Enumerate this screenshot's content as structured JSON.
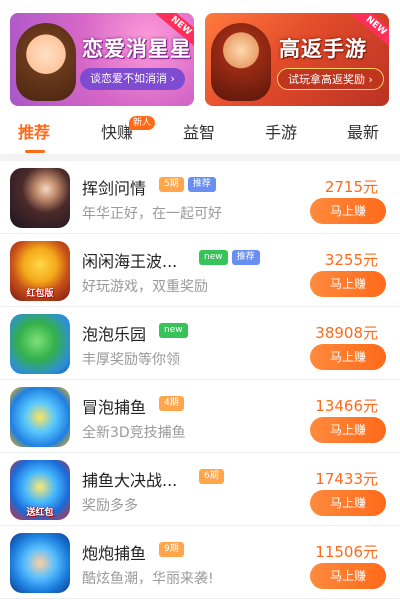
{
  "banners": [
    {
      "title": "恋爱消星星",
      "button": "谈恋爱不如消消 ›",
      "badge": "NEW",
      "mascot_icon": "anime-girl-icon"
    },
    {
      "title": "高返手游",
      "button": "试玩拿高返奖励 ›",
      "badge": "NEW",
      "mascot_icon": "hero-warrior-icon"
    }
  ],
  "tabs": [
    {
      "label": "推荐",
      "active": true
    },
    {
      "label": "快赚",
      "badge": "新人"
    },
    {
      "label": "益智"
    },
    {
      "label": "手游"
    },
    {
      "label": "最新"
    }
  ],
  "games": [
    {
      "name": "挥剑问情",
      "tags": [
        "5期",
        "推荐"
      ],
      "tag_types": [
        "period",
        "rec"
      ],
      "desc": "年华正好，在一起可好",
      "price": "2715元",
      "button": "马上赚",
      "icon_text": ""
    },
    {
      "name": "闲闲海王波...",
      "tags": [
        "new",
        "推荐"
      ],
      "tag_types": [
        "new",
        "rec"
      ],
      "desc": "好玩游戏，双重奖励",
      "price": "3255元",
      "button": "马上赚",
      "icon_text": "红包版"
    },
    {
      "name": "泡泡乐园",
      "tags": [
        "new"
      ],
      "tag_types": [
        "new"
      ],
      "desc": "丰厚奖励等你领",
      "price": "38908元",
      "button": "马上赚",
      "icon_text": ""
    },
    {
      "name": "冒泡捕鱼",
      "tags": [
        "4期"
      ],
      "tag_types": [
        "period"
      ],
      "desc": "全新3D竞技捕鱼",
      "price": "13466元",
      "button": "马上赚",
      "icon_text": ""
    },
    {
      "name": "捕鱼大决战...",
      "tags": [
        "6期"
      ],
      "tag_types": [
        "period"
      ],
      "desc": "奖励多多",
      "price": "17433元",
      "button": "马上赚",
      "icon_text": "送红包"
    },
    {
      "name": "炮炮捕鱼",
      "tags": [
        "9期"
      ],
      "tag_types": [
        "period"
      ],
      "desc": "酷炫鱼潮，华丽来袭!",
      "price": "11506元",
      "button": "马上赚",
      "icon_text": ""
    }
  ],
  "colors": {
    "accent": "#ff6a1a",
    "tag_period": "#ffa64d",
    "tag_recommend": "#6a8df2",
    "tag_new": "#37c25a"
  }
}
